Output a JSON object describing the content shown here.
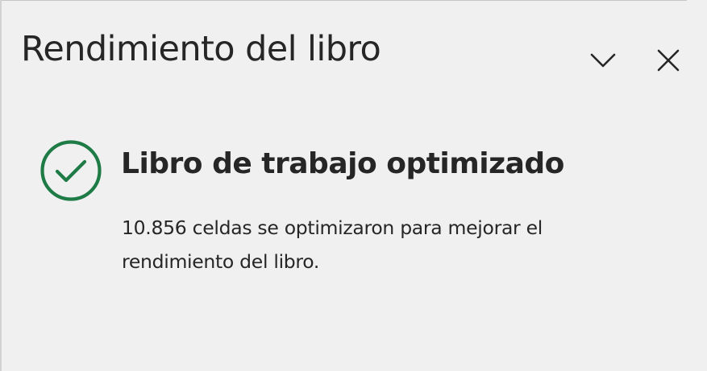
{
  "pane": {
    "title": "Rendimiento del libro",
    "collapse_icon": "chevron-down-icon",
    "close_icon": "close-icon"
  },
  "status": {
    "icon": "check-circle-icon",
    "icon_color": "#1e7b45",
    "title": "Libro de trabajo optimizado",
    "description": "10.856 celdas se optimizaron para mejorar el rendimiento del libro."
  },
  "colors": {
    "background": "#f0f0f0",
    "text": "#262626",
    "success": "#1e7b45"
  }
}
